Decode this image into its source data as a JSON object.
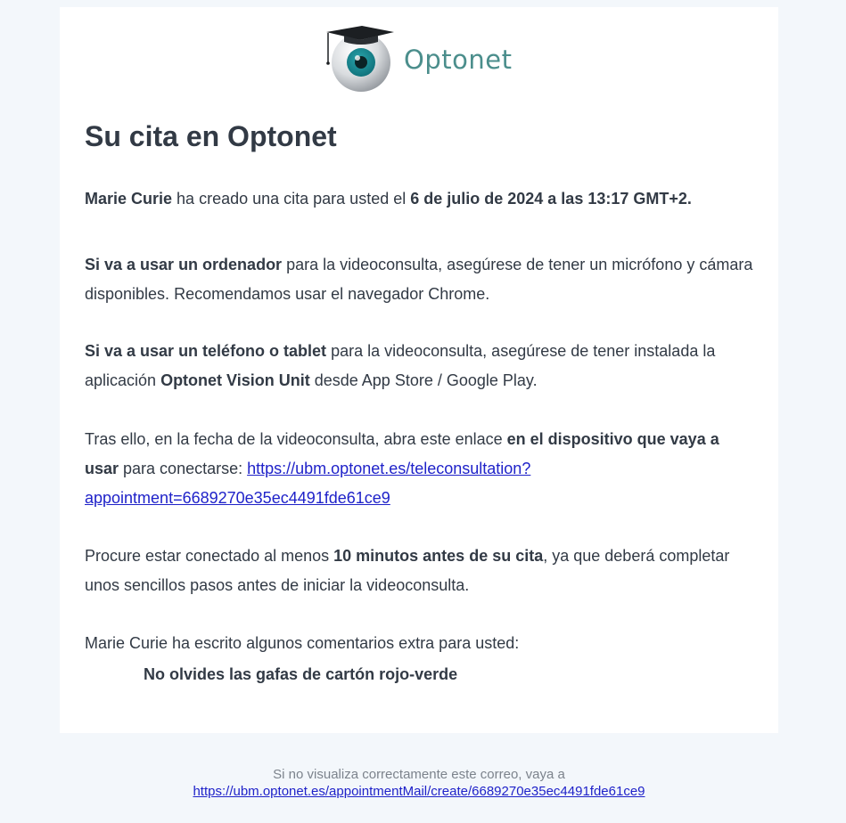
{
  "brand": {
    "name": "Optonet",
    "logo_icon": "eye-with-graduation-cap",
    "colors": {
      "brand_text": "#4b8e8c",
      "link": "#1f22c9",
      "text": "#323a45"
    }
  },
  "email": {
    "title": "Su cita en Optonet",
    "p1": {
      "name": "Marie Curie",
      "text": " ha creado una cita para usted el ",
      "date": "6 de julio de 2024 a las 13:17 GMT+2."
    },
    "p2": {
      "bold": "Si va a usar un ordenador",
      "text": " para la videoconsulta, asegúrese de tener un micrófono y cámara disponibles. Recomendamos usar el navegador Chrome."
    },
    "p3": {
      "bold": "Si va a usar un teléfono o tablet",
      "text1": " para la videoconsulta, asegúrese de tener instalada la aplicación ",
      "app": "Optonet Vision Unit",
      "text2": " desde App Store / Google Play."
    },
    "p4": {
      "text1": "Tras ello, en la fecha de la videoconsulta, abra este enlace ",
      "bold": "en el dispositivo que vaya a usar",
      "text2": " para conectarse: ",
      "link": "https://ubm.optonet.es/teleconsultation?appointment=6689270e35ec4491fde61ce9"
    },
    "p5": {
      "text1": "Procure estar conectado al menos ",
      "bold": "10 minutos antes de su cita",
      "text2": ", ya que deberá completar unos sencillos pasos antes de iniciar la videoconsulta."
    },
    "p6": "Marie Curie ha escrito algunos comentarios extra para usted:",
    "comment": "No olvides las gafas de cartón rojo-verde"
  },
  "footer": {
    "text": "Si no visualiza correctamente este correo, vaya a",
    "link": "https://ubm.optonet.es/appointmentMail/create/6689270e35ec4491fde61ce9"
  }
}
